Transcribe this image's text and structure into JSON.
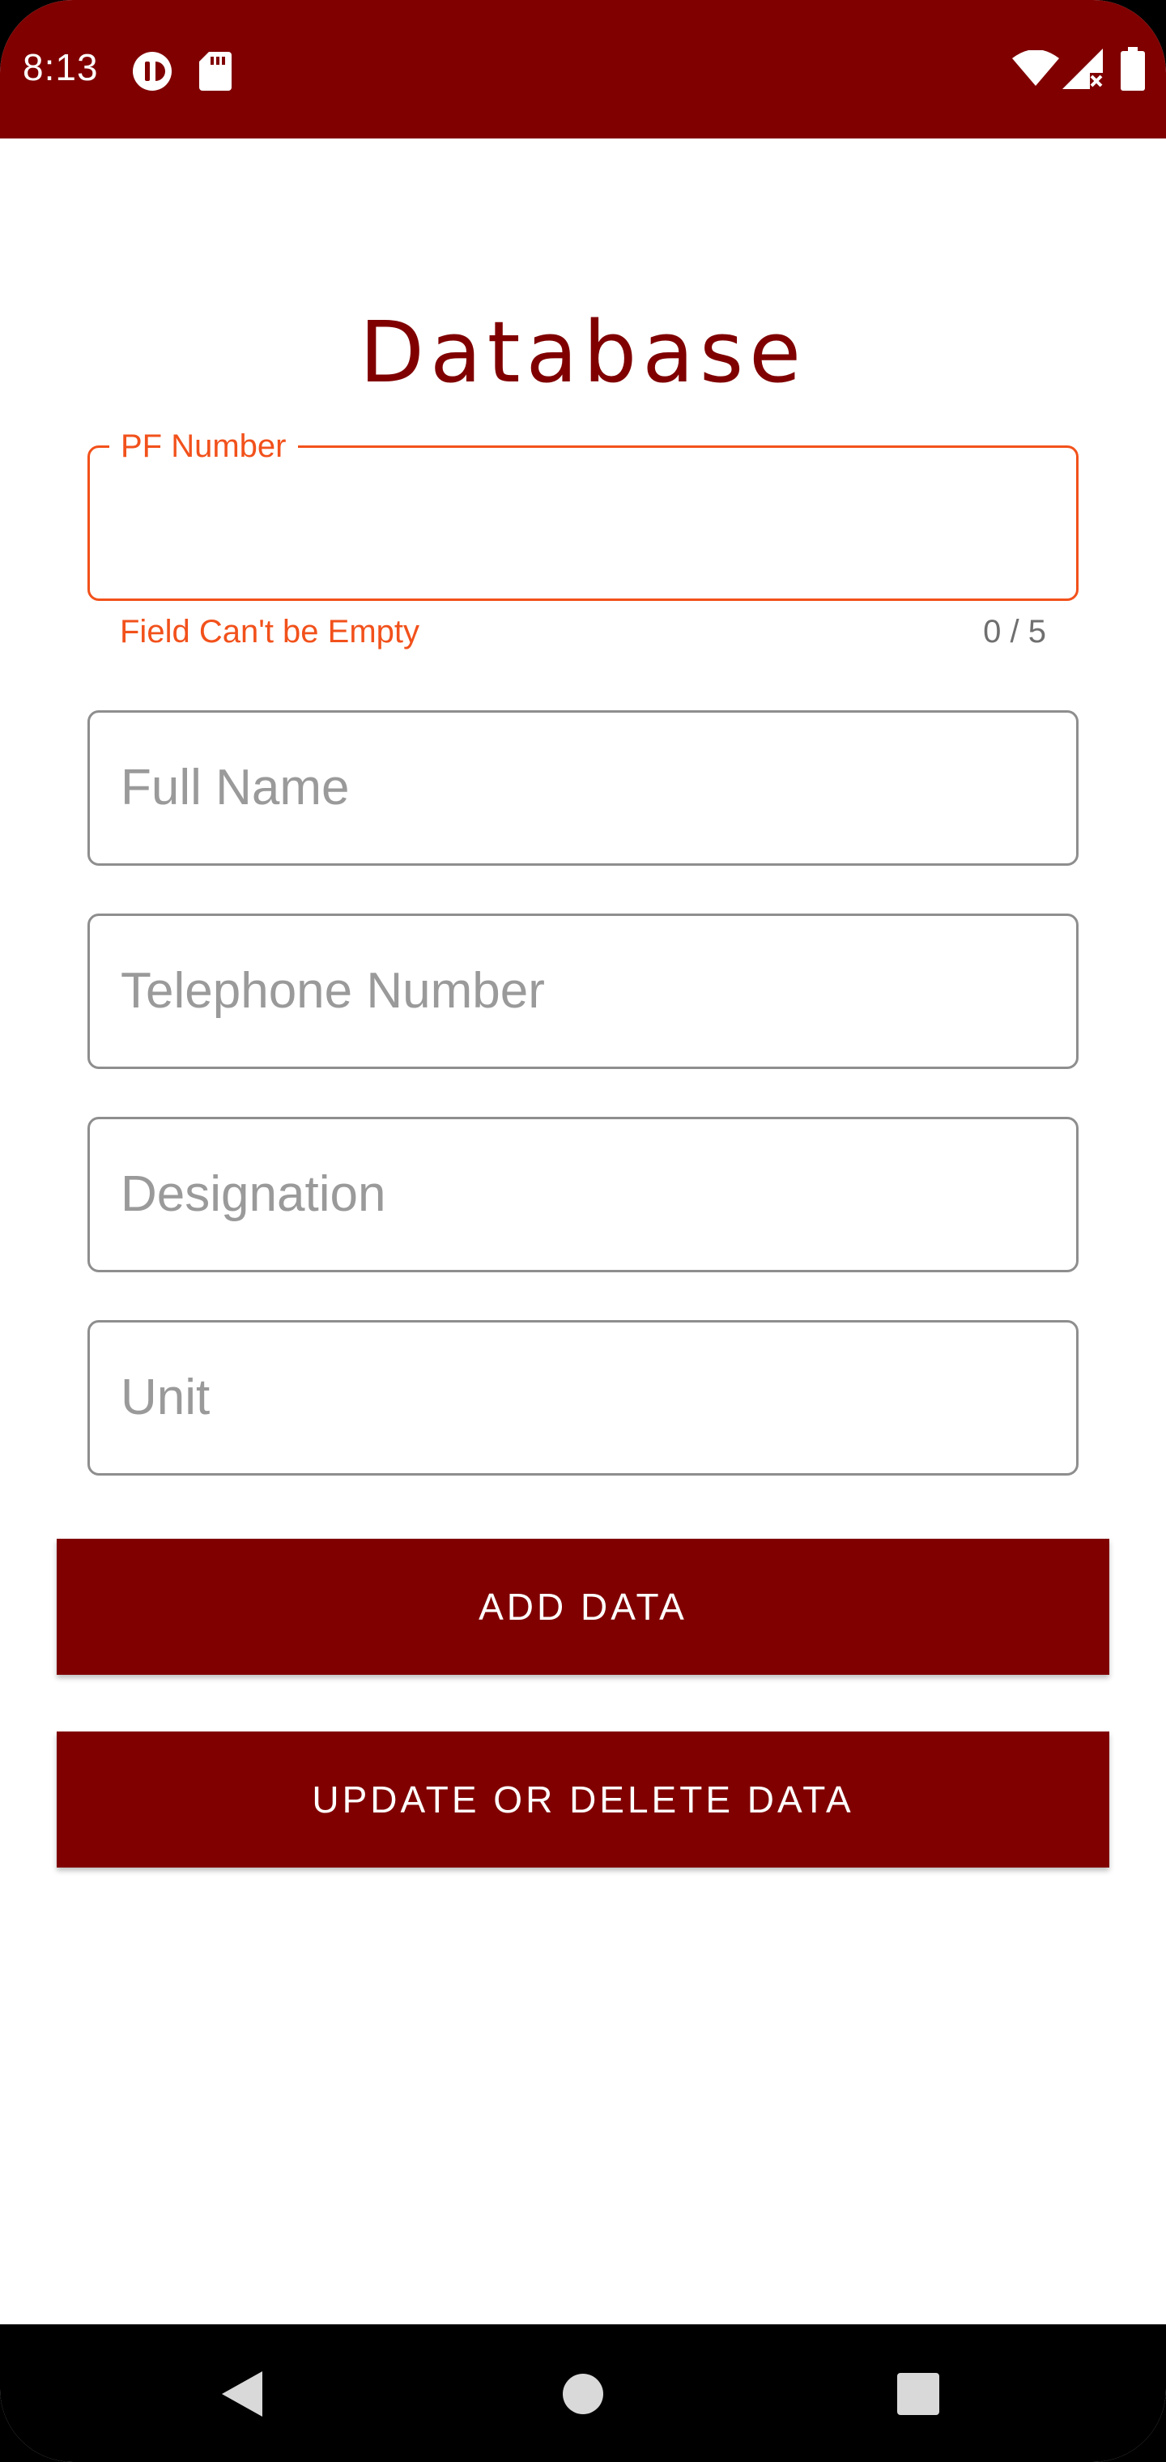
{
  "status_bar": {
    "time": "8:13",
    "color": "#800000",
    "icons": [
      "pause-circle-icon",
      "sd-card-icon",
      "wifi-icon",
      "cellular-signal-icon",
      "battery-icon"
    ]
  },
  "page": {
    "title": "Database",
    "accent_color": "#800000",
    "error_color": "#f2511b"
  },
  "form": {
    "pf_number": {
      "label": "PF Number",
      "value": "",
      "error": "Field Can't be Empty",
      "counter": "0 / 5"
    },
    "full_name": {
      "placeholder": "Full Name"
    },
    "telephone": {
      "placeholder": "Telephone Number"
    },
    "designation": {
      "placeholder": "Designation"
    },
    "unit": {
      "placeholder": "Unit"
    }
  },
  "buttons": {
    "add": "ADD DATA",
    "update_delete": "UPDATE OR DELETE DATA"
  },
  "nav_bar": {
    "icons": [
      "back-icon",
      "home-icon",
      "recents-icon"
    ]
  }
}
